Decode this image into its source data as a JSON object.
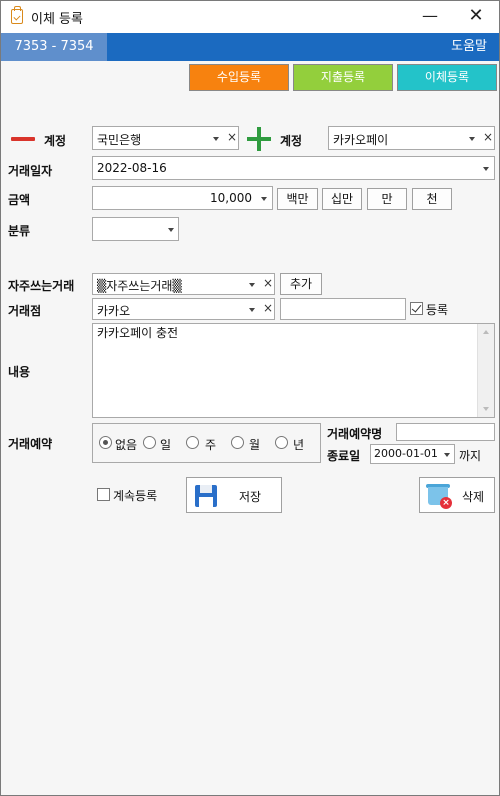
{
  "window": {
    "title": "이체 등록",
    "app_icon": "clipboard-icon",
    "minimize_icon": "minimize-icon",
    "minimize_glyph": "—",
    "close_icon": "close-icon",
    "close_glyph": "✕"
  },
  "header": {
    "range": "7353 - 7354",
    "help": "도움말"
  },
  "tabs": {
    "income": "수입등록",
    "expense": "지출등록",
    "transfer": "이체등록",
    "colors": {
      "income": "#f7820f",
      "expense": "#93cf3c",
      "transfer": "#23c3c9"
    }
  },
  "accounts": {
    "from_label": "계정",
    "from_value": "국민은행",
    "to_label": "계정",
    "to_value": "카카오페이",
    "minus_icon": "minus-icon",
    "plus_icon": "plus-icon",
    "minus_color": "#d9342b",
    "plus_color": "#2f9b3f"
  },
  "form": {
    "date_label": "거래일자",
    "date_value": "2022-08-16",
    "amount_label": "금액",
    "amount_value": "10,000",
    "amount_buttons": [
      "백만",
      "십만",
      "만",
      "천"
    ],
    "category_label": "분류",
    "category_value": "",
    "frequent_label": "자주쓰는거래",
    "frequent_value": "▒자주쓰는거래▒",
    "add_button": "추가",
    "store_label": "거래점",
    "store_value": "카카오",
    "store_extra_value": "",
    "register_label": "등록",
    "register_checked": true,
    "memo_label": "내용",
    "memo_value": "카카오페이 충전"
  },
  "reservation": {
    "label": "거래예약",
    "options": [
      "없음",
      "일",
      "주",
      "월",
      "년"
    ],
    "selected": "없음",
    "name_label": "거래예약명",
    "name_value": "",
    "end_label": "종료일",
    "end_value": "2000-01-01",
    "until_label": "까지"
  },
  "footer": {
    "continue_label": "계속등록",
    "continue_checked": false,
    "save_label": "저장",
    "delete_label": "삭제",
    "save_icon": "floppy-disk-icon",
    "delete_icon": "trash-icon"
  }
}
